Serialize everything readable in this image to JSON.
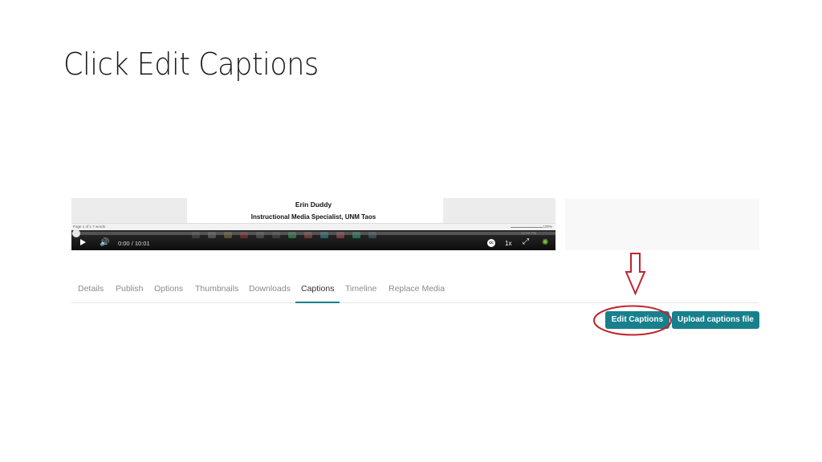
{
  "slide": {
    "title": "Click Edit Captions"
  },
  "player": {
    "doc_name": "Erin Duddy",
    "doc_subtitle": "Instructional Media Specialist, UNM Taos",
    "status_left": "Page 1 of 1    7 words    ",
    "status_right": "100%",
    "clock": "12:03 PM",
    "current_time": "0:00",
    "duration": "/ 10:01",
    "cc_label": "cc",
    "speed": "1x",
    "progress_fraction": 0.0
  },
  "tabs": [
    {
      "label": "Details",
      "active": false
    },
    {
      "label": "Publish",
      "active": false
    },
    {
      "label": "Options",
      "active": false
    },
    {
      "label": "Thumbnails",
      "active": false
    },
    {
      "label": "Downloads",
      "active": false
    },
    {
      "label": "Captions",
      "active": true
    },
    {
      "label": "Timeline",
      "active": false
    },
    {
      "label": "Replace Media",
      "active": false
    }
  ],
  "actions": {
    "edit_captions": "Edit Captions",
    "upload_captions": "Upload captions file"
  },
  "annotation": {
    "color": "#c0242c"
  },
  "icons": {
    "play": "play-icon",
    "volume": "volume-icon",
    "cc": "closed-captions-icon",
    "fullscreen": "fullscreen-icon",
    "kaltura": "kaltura-logo-icon"
  }
}
